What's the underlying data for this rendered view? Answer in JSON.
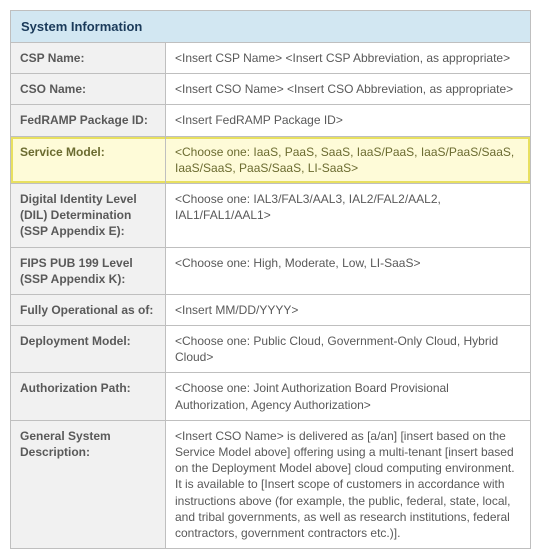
{
  "title": "System Information",
  "rows": [
    {
      "label": "CSP Name:",
      "value": "<Insert CSP Name> <Insert CSP Abbreviation, as appropriate>",
      "highlight": false
    },
    {
      "label": "CSO Name:",
      "value": "<Insert CSO Name> <Insert CSO Abbreviation, as appropriate>",
      "highlight": false
    },
    {
      "label": "FedRAMP Package ID:",
      "value": "<Insert FedRAMP Package ID>",
      "highlight": false
    },
    {
      "label": "Service Model:",
      "value": "<Choose one: IaaS, PaaS, SaaS, IaaS/PaaS, IaaS/PaaS/SaaS, IaaS/SaaS, PaaS/SaaS, LI-SaaS>",
      "highlight": true
    },
    {
      "label": "Digital Identity Level (DIL) Determination (SSP Appendix E):",
      "value": "<Choose one: IAL3/FAL3/AAL3, IAL2/FAL2/AAL2, IAL1/FAL1/AAL1>",
      "highlight": false
    },
    {
      "label": "FIPS PUB 199 Level (SSP Appendix K):",
      "value": "<Choose one: High, Moderate, Low, LI-SaaS>",
      "highlight": false
    },
    {
      "label": "Fully Operational as of:",
      "value": "<Insert MM/DD/YYYY>",
      "highlight": false
    },
    {
      "label": "Deployment Model:",
      "value": "<Choose one: Public Cloud, Government-Only Cloud, Hybrid Cloud>",
      "highlight": false
    },
    {
      "label": "Authorization Path:",
      "value": "<Choose one: Joint Authorization Board Provisional Authorization, Agency Authorization>",
      "highlight": false
    },
    {
      "label": "General System Description:",
      "value": "<Insert CSO Name> is delivered as [a/an] [insert based on the Service Model above] offering using a multi-tenant [insert based on the Deployment Model above] cloud computing environment. It is available to [Insert scope of customers in accordance with instructions above (for example, the public, federal, state, local, and tribal governments, as well as research institutions, federal contractors, government contractors etc.)].",
      "highlight": false
    }
  ]
}
